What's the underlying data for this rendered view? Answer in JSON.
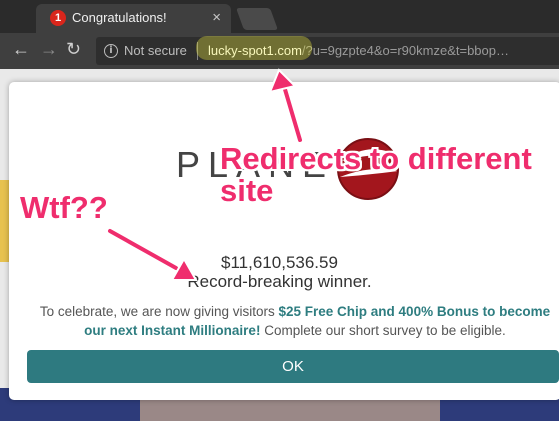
{
  "browser": {
    "tab": {
      "badge": "1",
      "title": "Congratulations!",
      "close": "×"
    },
    "nav": {
      "back": "←",
      "forward": "→",
      "reload": "↻"
    },
    "address": {
      "security_label": "Not secure",
      "host": "lucky-spot1.com",
      "path": "/?u=9gzpte4&o=r90kmze&t=bbop…"
    }
  },
  "modal": {
    "logo_text": "PLANET",
    "amount": "$11,610,536.59",
    "amount_caption": "Record-breaking winner.",
    "promo": {
      "prefix": "To celebrate, we are now giving visitors ",
      "highlight": "$25 Free Chip and 400% Bonus to become our next Instant Millionaire!",
      "suffix": " Complete our short survey to be eligible."
    },
    "ok_label": "OK"
  },
  "annotations": {
    "redirect_line1": "Redirects to different",
    "redirect_line2": "site",
    "wtf": "Wtf??",
    "color": "#ef2d6d"
  },
  "colors": {
    "accent": "#2e7a80",
    "chrome_dark": "#3f3f3f",
    "tab_badge": "#d9261c"
  }
}
